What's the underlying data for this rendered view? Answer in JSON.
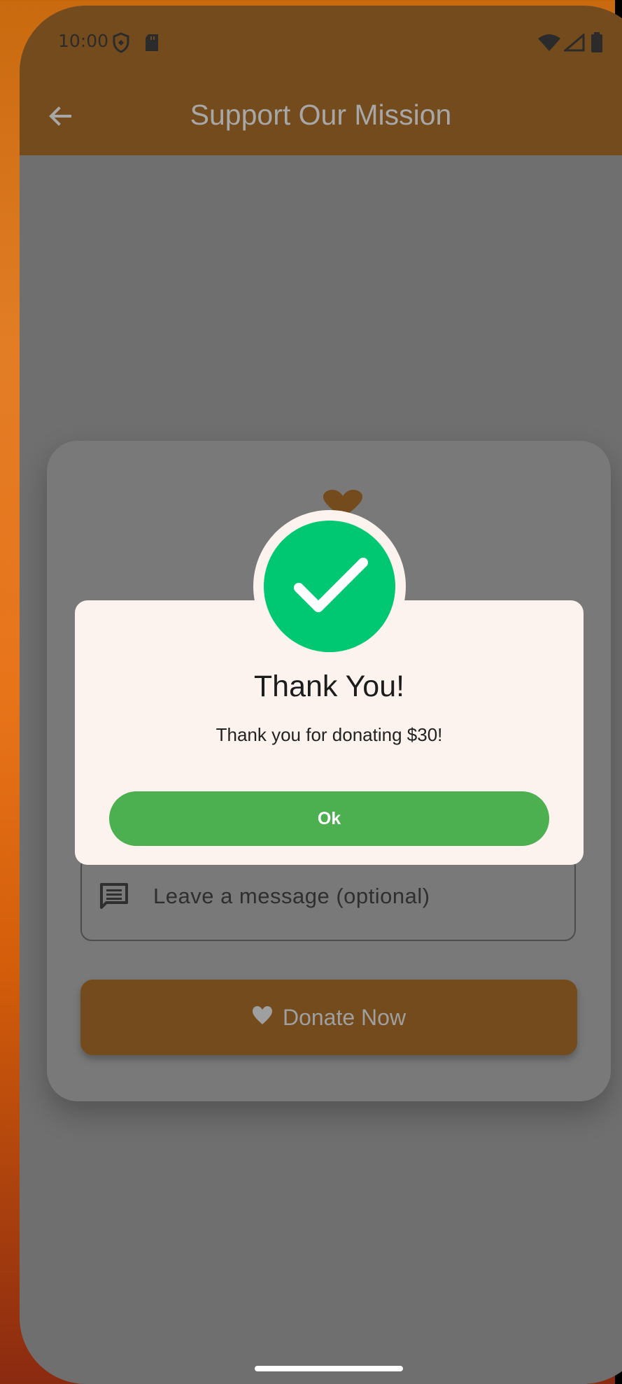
{
  "status_bar": {
    "time": "10:00",
    "icons": [
      "shield-icon",
      "sd-card-icon",
      "wifi-icon",
      "signal-icon",
      "battery-icon"
    ]
  },
  "app_bar": {
    "title": "Support Our Mission",
    "back_icon": "arrow-back-icon",
    "color": "#744b1d"
  },
  "form": {
    "message_placeholder": "Leave a message (optional)",
    "donate_button_label": "Donate Now"
  },
  "dialog": {
    "title": "Thank You!",
    "message": "Thank you for donating $30!",
    "ok_label": "Ok",
    "check_color": "#00c872",
    "ok_color": "#4caf50"
  }
}
